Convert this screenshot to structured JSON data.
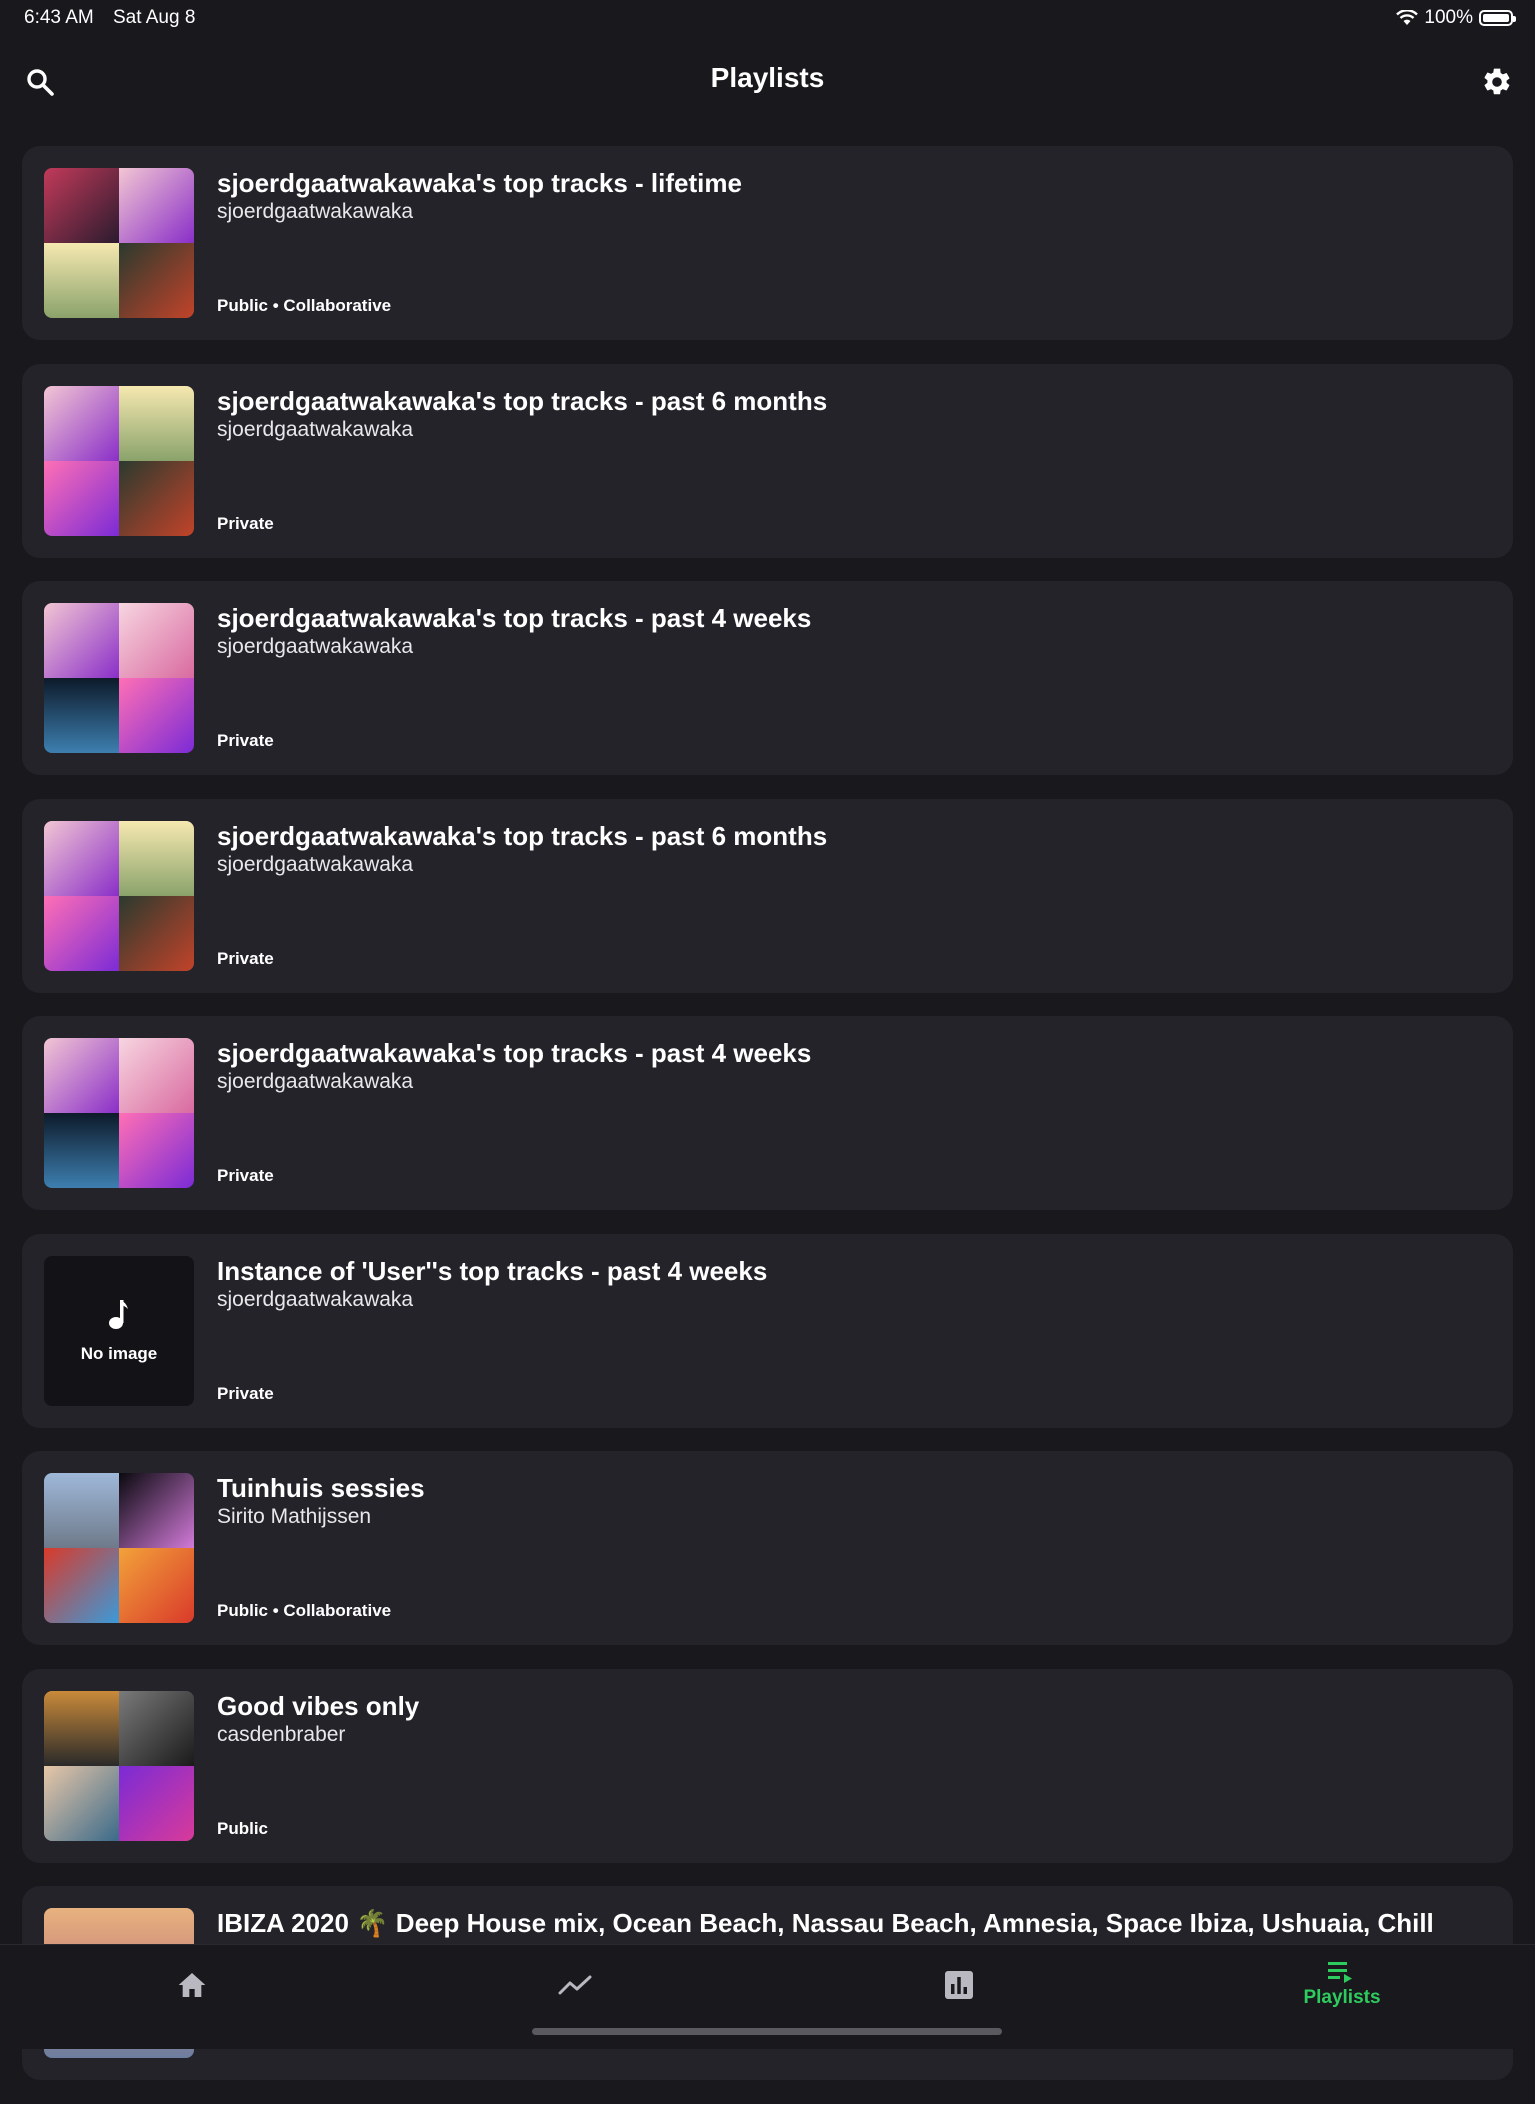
{
  "status_bar": {
    "time": "6:43 AM",
    "date": "Sat Aug 8",
    "battery": "100%"
  },
  "header": {
    "title": "Playlists",
    "left_icon": "search-icon",
    "right_icon": "gear-icon"
  },
  "colors": {
    "background": "#19181d",
    "card": "#24232a",
    "accent": "#2ecc5f"
  },
  "playlists": [
    {
      "title": "sjoerdgaatwakawaka's top tracks - lifetime",
      "owner": "sjoerdgaatwakawaka",
      "meta": "Public • Collaborative"
    },
    {
      "title": "sjoerdgaatwakawaka's top tracks - past 6 months",
      "owner": "sjoerdgaatwakawaka",
      "meta": "Private"
    },
    {
      "title": "sjoerdgaatwakawaka's top tracks - past 4 weeks",
      "owner": "sjoerdgaatwakawaka",
      "meta": "Private"
    },
    {
      "title": "sjoerdgaatwakawaka's top tracks - past 6 months",
      "owner": "sjoerdgaatwakawaka",
      "meta": "Private"
    },
    {
      "title": "sjoerdgaatwakawaka's top tracks - past 4 weeks",
      "owner": "sjoerdgaatwakawaka",
      "meta": "Private"
    },
    {
      "title": "Instance of 'User''s top tracks - past 4 weeks",
      "owner": "sjoerdgaatwakawaka",
      "meta": "Private",
      "no_image_label": "No image"
    },
    {
      "title": "Tuinhuis sessies",
      "owner": "Sirito Mathijssen",
      "meta": "Public • Collaborative"
    },
    {
      "title": "Good vibes only",
      "owner": "casdenbraber",
      "meta": "Public"
    },
    {
      "title": "IBIZA 2020 🌴 Deep House mix, Ocean Beach, Nassau Beach, Amnesia, Space Ibiza, Ushuaia, Chill",
      "owner": "",
      "meta": ""
    }
  ],
  "tab_bar": {
    "tabs": [
      {
        "icon": "home-icon"
      },
      {
        "icon": "trending-icon"
      },
      {
        "icon": "bar-chart-icon"
      },
      {
        "icon": "playlist-icon",
        "label": "Playlists",
        "active": true
      }
    ]
  }
}
